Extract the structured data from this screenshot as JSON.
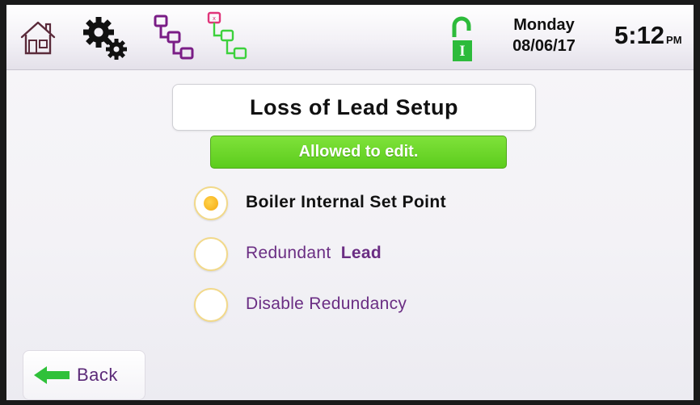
{
  "header": {
    "icons": [
      "home-icon",
      "settings-gears-icon",
      "network-tree-icon",
      "network-tree-alert-icon",
      "unlocked-padlock-icon"
    ],
    "lock_letter": "I",
    "day": "Monday",
    "date": "08/06/17",
    "time": "5:12",
    "ampm": "PM"
  },
  "main": {
    "title": "Loss of Lead Setup",
    "status": "Allowed to edit.",
    "options": [
      {
        "label": "Boiler Internal Set Point",
        "selected": true
      },
      {
        "label_a": "Redundant",
        "label_b": "Lead",
        "selected": false
      },
      {
        "label": "Disable Redundancy",
        "selected": false
      }
    ]
  },
  "footer": {
    "back_label": "Back"
  },
  "colors": {
    "accent_purple": "#6a2d83",
    "status_green": "#5ccc1d",
    "radio_yellow": "#f5a90f",
    "lock_green": "#2dbb3b"
  }
}
